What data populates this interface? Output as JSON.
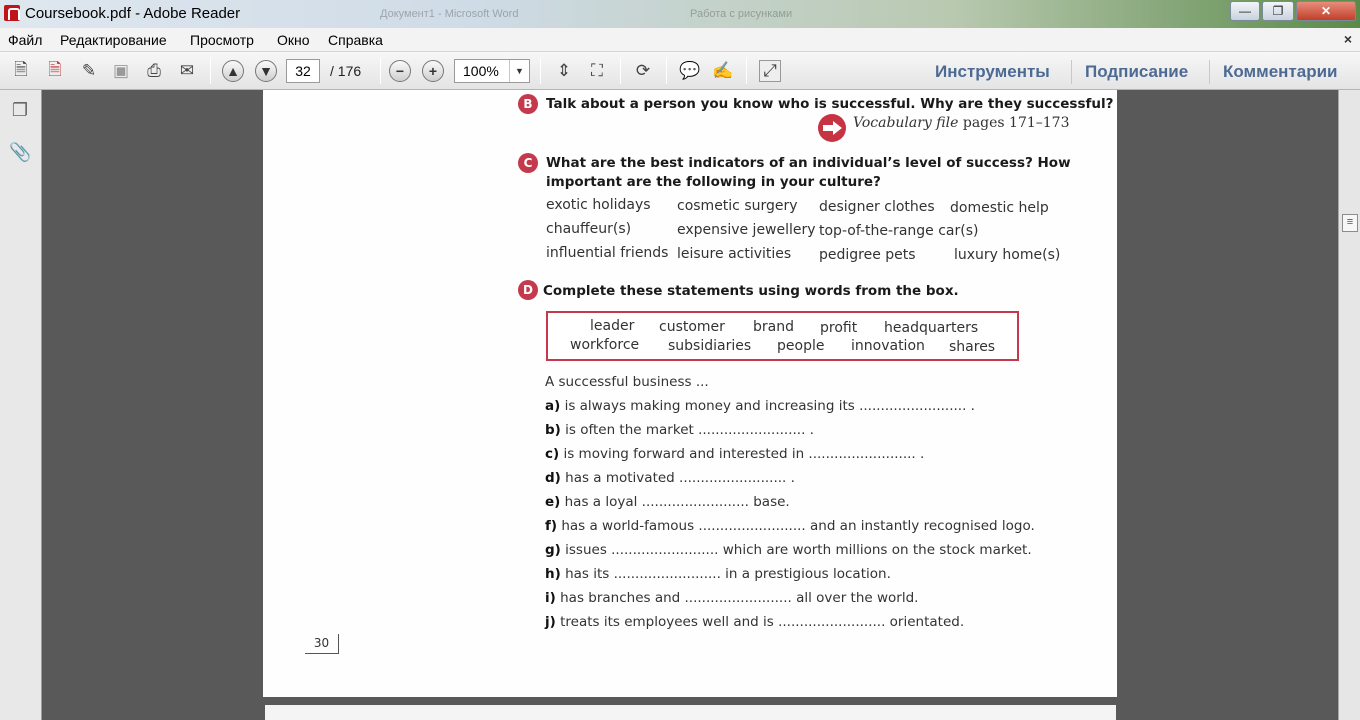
{
  "window": {
    "title": "Coursebook.pdf - Adobe Reader",
    "ghost_tabs": [
      "Документ1 - Microsoft Word",
      "Работа с рисунками"
    ],
    "buttons": {
      "minimize": "—",
      "maximize": "❐",
      "close": "✕"
    }
  },
  "menu": {
    "items": [
      "Файл",
      "Редактирование",
      "Просмотр",
      "Окно",
      "Справка"
    ],
    "close_glyph": "×"
  },
  "toolbar": {
    "current_page": "32",
    "total_pages": "/  176",
    "zoom": "100%",
    "links": {
      "tools": "Инструменты",
      "sign": "Подписание",
      "comments": "Комментарии"
    }
  },
  "doc": {
    "section_b": {
      "badge": "B",
      "question": "Talk about a person you know who is successful. Why are they successful?",
      "vocab_label": "Vocabulary file",
      "vocab_pages": "pages 171–173"
    },
    "section_c": {
      "badge": "C",
      "question_line1": "What are the best indicators of an individual’s level of success? How",
      "question_line2": "important are the following in your culture?",
      "items": [
        "exotic holidays",
        "cosmetic surgery",
        "designer clothes",
        "domestic help",
        "chauffeur(s)",
        "expensive jewellery",
        "top-of-the-range car(s)",
        "influential friends",
        "leisure activities",
        "pedigree pets",
        "luxury home(s)"
      ]
    },
    "section_d": {
      "badge": "D",
      "question": "Complete these statements using words from the box.",
      "box_words": [
        "leader",
        "customer",
        "brand",
        "profit",
        "headquarters",
        "workforce",
        "subsidiaries",
        "people",
        "innovation",
        "shares"
      ],
      "intro": "A successful business ...",
      "statements": [
        {
          "letter": "a)",
          "text": "is always making money and increasing its ......................... ."
        },
        {
          "letter": "b)",
          "text": "is often the market ......................... ."
        },
        {
          "letter": "c)",
          "text": "is moving forward and interested in ......................... ."
        },
        {
          "letter": "d)",
          "text": "has a motivated ......................... ."
        },
        {
          "letter": "e)",
          "text": "has a loyal ......................... base."
        },
        {
          "letter": "f)",
          "text": "has a world-famous ......................... and an instantly recognised logo."
        },
        {
          "letter": "g)",
          "text": "issues ......................... which are worth millions on the stock market."
        },
        {
          "letter": "h)",
          "text": "has its ......................... in a prestigious location."
        },
        {
          "letter": "i)",
          "text": "has branches and ......................... all over the world."
        },
        {
          "letter": "j)",
          "text": "treats its employees well and is ......................... orientated."
        }
      ]
    },
    "page_number": "30"
  },
  "colors": {
    "accent_red": "#c43a4c",
    "link_blue": "#4d6a93"
  }
}
